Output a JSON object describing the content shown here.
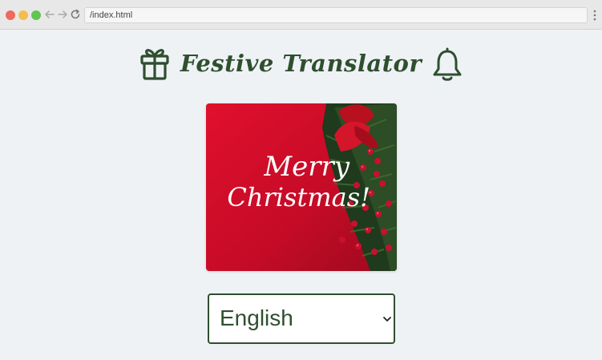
{
  "browser": {
    "url": "/index.html"
  },
  "header": {
    "title": "Festive Translator",
    "left_icon": "gift-icon",
    "right_icon": "bell-icon"
  },
  "card": {
    "line1": "Merry",
    "line2": "Christmas!"
  },
  "language_select": {
    "selected": "English"
  },
  "colors": {
    "accent": "#2f4f2f",
    "background": "#eef2f5",
    "card_red": "#c8102e"
  }
}
